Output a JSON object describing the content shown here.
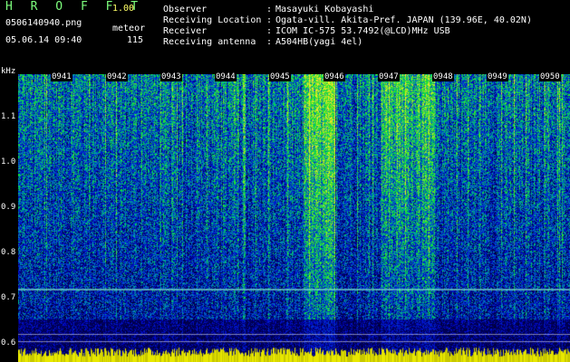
{
  "app": {
    "brand": "H R O F F T",
    "version": "1.00"
  },
  "file": {
    "name": "0506140940.png",
    "datetime": "05.06.14 09:40"
  },
  "meteor": {
    "label": "meteor",
    "count": "115"
  },
  "info": [
    {
      "label": "Observer",
      "value": "Masayuki Kobayashi"
    },
    {
      "label": "Receiving Location",
      "value": "Ogata-vill. Akita-Pref. JAPAN (139.96E, 40.02N)"
    },
    {
      "label": "Receiver",
      "value": "ICOM IC-575 53.7492(@LCD)MHz USB"
    },
    {
      "label": "Receiving antenna",
      "value": "A504HB(yagi 4el)"
    }
  ],
  "info_separator": ":",
  "axis": {
    "unit": "kHz",
    "y_ticks": [
      "1.1",
      "1.0",
      "0.9",
      "0.8",
      "0.7",
      "0.6"
    ],
    "x_ticks": [
      "0941",
      "0942",
      "0943",
      "0944",
      "0945",
      "0946",
      "0947",
      "0948",
      "0949",
      "0950"
    ]
  },
  "colors": {
    "title": "#7cfc7c",
    "version": "#ffff66",
    "text": "#ffffff",
    "background": "#000000"
  }
}
